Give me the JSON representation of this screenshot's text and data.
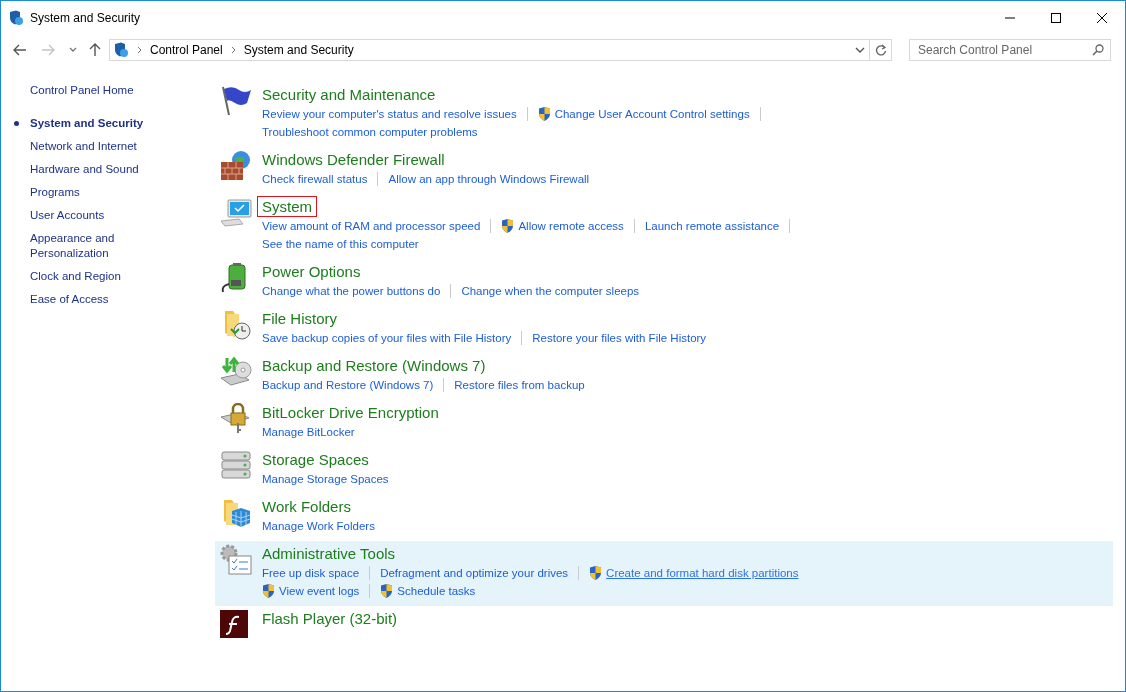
{
  "window": {
    "title": "System and Security"
  },
  "address_bar": {
    "breadcrumbs": [
      "Control Panel",
      "System and Security"
    ]
  },
  "search": {
    "placeholder": "Search Control Panel"
  },
  "sidebar": {
    "items": [
      {
        "label": "Control Panel Home",
        "selected": false
      },
      {
        "label": "System and Security",
        "selected": true
      },
      {
        "label": "Network and Internet",
        "selected": false
      },
      {
        "label": "Hardware and Sound",
        "selected": false
      },
      {
        "label": "Programs",
        "selected": false
      },
      {
        "label": "User Accounts",
        "selected": false
      },
      {
        "label": "Appearance and Personalization",
        "selected": false
      },
      {
        "label": "Clock and Region",
        "selected": false
      },
      {
        "label": "Ease of Access",
        "selected": false
      }
    ]
  },
  "categories": [
    {
      "kind": "flag",
      "title": "Security and Maintenance",
      "outlined": false,
      "highlighted": false,
      "lines": [
        [
          {
            "text": "Review your computer's status and resolve issues",
            "shield": false,
            "hovered": false
          },
          {
            "text": "Change User Account Control settings",
            "shield": true,
            "hovered": false
          }
        ],
        [
          {
            "text": "Troubleshoot common computer problems",
            "shield": false,
            "hovered": false
          }
        ]
      ]
    },
    {
      "kind": "firewall",
      "title": "Windows Defender Firewall",
      "outlined": false,
      "highlighted": false,
      "lines": [
        [
          {
            "text": "Check firewall status",
            "shield": false,
            "hovered": false
          },
          {
            "text": "Allow an app through Windows Firewall",
            "shield": false,
            "hovered": false
          }
        ]
      ]
    },
    {
      "kind": "computer",
      "title": "System",
      "outlined": true,
      "highlighted": false,
      "lines": [
        [
          {
            "text": "View amount of RAM and processor speed",
            "shield": false,
            "hovered": false
          },
          {
            "text": "Allow remote access",
            "shield": true,
            "hovered": false
          },
          {
            "text": "Launch remote assistance",
            "shield": false,
            "hovered": false
          }
        ],
        [
          {
            "text": "See the name of this computer",
            "shield": false,
            "hovered": false
          }
        ]
      ]
    },
    {
      "kind": "battery",
      "title": "Power Options",
      "outlined": false,
      "highlighted": false,
      "lines": [
        [
          {
            "text": "Change what the power buttons do",
            "shield": false,
            "hovered": false
          },
          {
            "text": "Change when the computer sleeps",
            "shield": false,
            "hovered": false
          }
        ]
      ]
    },
    {
      "kind": "folder-clock",
      "title": "File History",
      "outlined": false,
      "highlighted": false,
      "lines": [
        [
          {
            "text": "Save backup copies of your files with File History",
            "shield": false,
            "hovered": false
          },
          {
            "text": "Restore your files with File History",
            "shield": false,
            "hovered": false
          }
        ]
      ]
    },
    {
      "kind": "backup",
      "title": "Backup and Restore (Windows 7)",
      "outlined": false,
      "highlighted": false,
      "lines": [
        [
          {
            "text": "Backup and Restore (Windows 7)",
            "shield": false,
            "hovered": false
          },
          {
            "text": "Restore files from backup",
            "shield": false,
            "hovered": false
          }
        ]
      ]
    },
    {
      "kind": "lock",
      "title": "BitLocker Drive Encryption",
      "outlined": false,
      "highlighted": false,
      "lines": [
        [
          {
            "text": "Manage BitLocker",
            "shield": false,
            "hovered": false
          }
        ]
      ]
    },
    {
      "kind": "drives",
      "title": "Storage Spaces",
      "outlined": false,
      "highlighted": false,
      "lines": [
        [
          {
            "text": "Manage Storage Spaces",
            "shield": false,
            "hovered": false
          }
        ]
      ]
    },
    {
      "kind": "folder-cubes",
      "title": "Work Folders",
      "outlined": false,
      "highlighted": false,
      "lines": [
        [
          {
            "text": "Manage Work Folders",
            "shield": false,
            "hovered": false
          }
        ]
      ]
    },
    {
      "kind": "tools",
      "title": "Administrative Tools",
      "outlined": false,
      "highlighted": true,
      "lines": [
        [
          {
            "text": "Free up disk space",
            "shield": false,
            "hovered": false
          },
          {
            "text": "Defragment and optimize your drives",
            "shield": false,
            "hovered": false
          },
          {
            "text": "Create and format hard disk partitions",
            "shield": true,
            "hovered": true
          }
        ],
        [
          {
            "text": "View event logs",
            "shield": true,
            "hovered": false
          },
          {
            "text": "Schedule tasks",
            "shield": true,
            "hovered": false
          }
        ]
      ]
    },
    {
      "kind": "flash",
      "title": "Flash Player (32-bit)",
      "outlined": false,
      "highlighted": false
    }
  ]
}
